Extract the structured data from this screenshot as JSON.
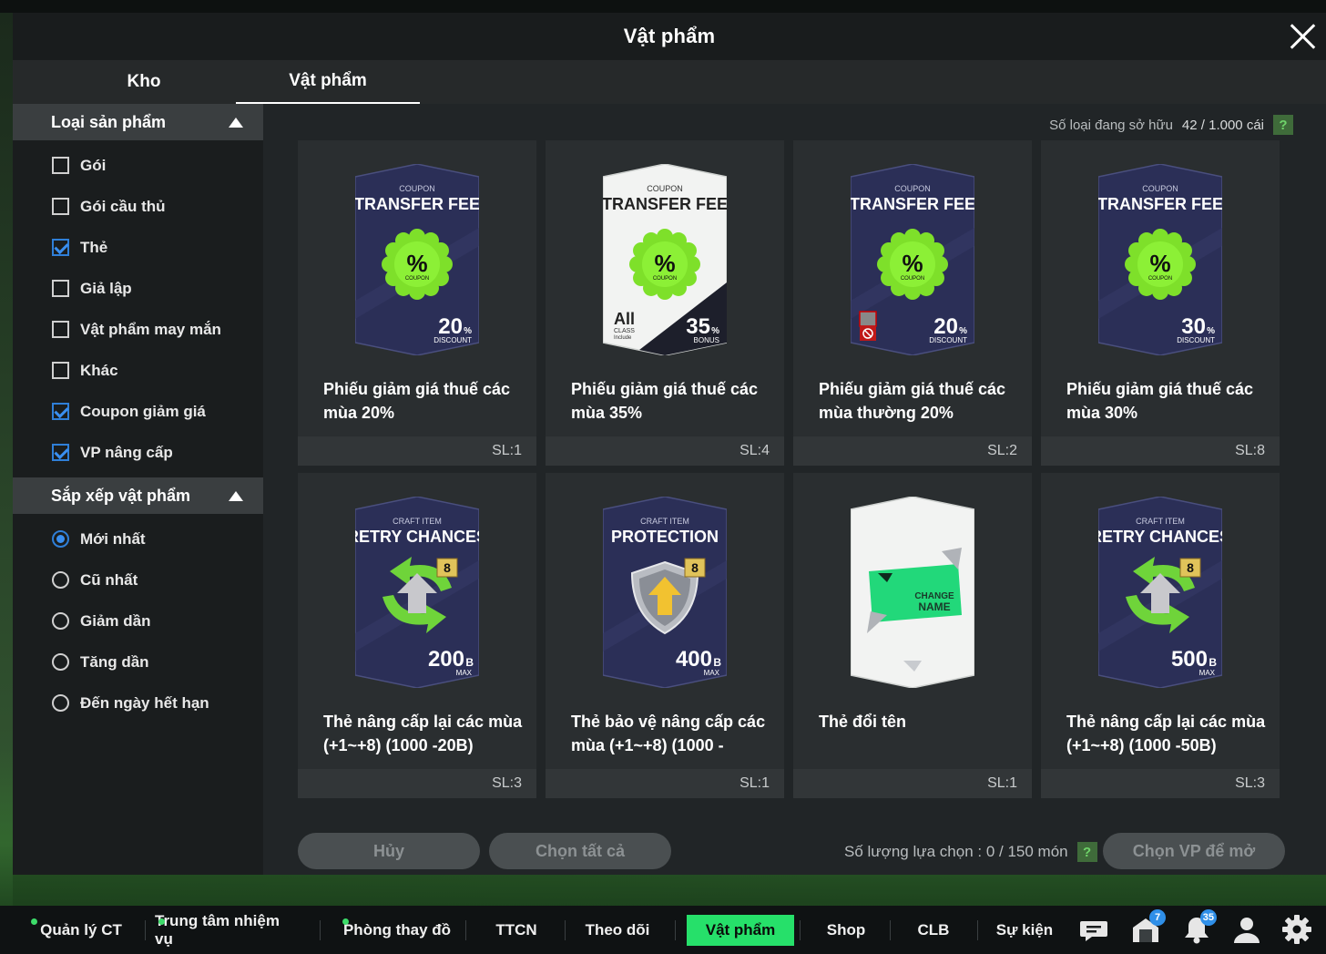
{
  "modal": {
    "title": "Vật phẩm"
  },
  "tabs": [
    {
      "label": "Kho"
    },
    {
      "label": "Vật phẩm"
    }
  ],
  "sidebar": {
    "filter_title": "Loại sản phẩm",
    "filters": [
      {
        "label": "Gói",
        "checked": false
      },
      {
        "label": "Gói cầu thủ",
        "checked": false
      },
      {
        "label": "Thẻ",
        "checked": true
      },
      {
        "label": "Giả lập",
        "checked": false
      },
      {
        "label": "Vật phẩm may mắn",
        "checked": false
      },
      {
        "label": "Khác",
        "checked": false
      },
      {
        "label": "Coupon giảm giá",
        "checked": true
      },
      {
        "label": "VP nâng cấp",
        "checked": true
      }
    ],
    "sort_title": "Sắp xếp vật phẩm",
    "sorts": [
      {
        "label": "Mới nhất",
        "selected": true
      },
      {
        "label": "Cũ nhất",
        "selected": false
      },
      {
        "label": "Giảm dần",
        "selected": false
      },
      {
        "label": "Tăng dần",
        "selected": false
      },
      {
        "label": "Đến ngày hết hạn",
        "selected": false
      }
    ]
  },
  "owned": {
    "label": "Số loại đang sở hữu",
    "count": "42 / 1.000 cái",
    "help": "?"
  },
  "items": [
    {
      "name": "Phiếu giảm giá thuế các mùa 20%",
      "qty": "SL:1",
      "art": {
        "kind": "coupon",
        "theme": "dark",
        "top": "COUPON",
        "title": "TRANSFER FEE",
        "badge": "%",
        "badge_sub": "COUPON",
        "value": "20",
        "unit": "%",
        "sub": "DISCOUNT"
      }
    },
    {
      "name": "Phiếu giảm giá thuế các mùa 35%",
      "qty": "SL:4",
      "art": {
        "kind": "coupon",
        "theme": "light",
        "top": "COUPON",
        "title": "TRANSFER FEE",
        "badge": "%",
        "badge_sub": "COUPON",
        "value": "35",
        "unit": "%",
        "sub": "BONUS",
        "corner_big": "All",
        "corner_small1": "CLASS",
        "corner_small2": "Include"
      }
    },
    {
      "name": "Phiếu giảm giá thuế các mùa thường 20%",
      "qty": "SL:2",
      "art": {
        "kind": "coupon",
        "theme": "dark",
        "top": "COUPON",
        "title": "TRANSFER FEE",
        "badge": "%",
        "badge_sub": "COUPON",
        "value": "20",
        "unit": "%",
        "sub": "DISCOUNT",
        "restricted": true
      }
    },
    {
      "name": "Phiếu giảm giá thuế các mùa 30%",
      "qty": "SL:8",
      "art": {
        "kind": "coupon",
        "theme": "dark",
        "top": "COUPON",
        "title": "TRANSFER FEE",
        "badge": "%",
        "badge_sub": "COUPON",
        "value": "30",
        "unit": "%",
        "sub": "DISCOUNT"
      }
    },
    {
      "name": "Thẻ nâng cấp lại các mùa (+1~+8) (1000 -20B)",
      "qty": "SL:3",
      "art": {
        "kind": "retry",
        "theme": "dark",
        "top": "CRAFT ITEM",
        "title": "RETRY CHANCES",
        "level": "8",
        "value": "200",
        "unit": "B",
        "sub": "MAX"
      }
    },
    {
      "name": "Thẻ bảo vệ nâng cấp các mùa (+1~+8) (1000 -",
      "qty": "SL:1",
      "art": {
        "kind": "protect",
        "theme": "dark",
        "top": "CRAFT ITEM",
        "title": "PROTECTION",
        "level": "8",
        "value": "400",
        "unit": "B",
        "sub": "MAX"
      }
    },
    {
      "name": "Thẻ đổi tên",
      "qty": "SL:1",
      "art": {
        "kind": "rename",
        "theme": "light",
        "line1": "CHANGE",
        "line2": "NAME"
      }
    },
    {
      "name": "Thẻ nâng cấp lại các mùa (+1~+8) (1000 -50B)",
      "qty": "SL:3",
      "art": {
        "kind": "retry",
        "theme": "dark",
        "top": "CRAFT ITEM",
        "title": "RETRY CHANCES",
        "level": "8",
        "value": "500",
        "unit": "B",
        "sub": "MAX"
      }
    }
  ],
  "actions": {
    "cancel": "Hủy",
    "select_all": "Chọn tất cả",
    "selection_label": "Số lượng lựa chọn : 0 / 150 món",
    "help": "?",
    "open": "Chọn VP để mở"
  },
  "bottom_nav": {
    "items": [
      {
        "label": "Quản lý CT",
        "dot": true
      },
      {
        "label": "Trung tâm nhiệm vụ",
        "dot": true
      },
      {
        "label": "Phòng thay đồ",
        "dot": true
      },
      {
        "label": "TTCN",
        "dot": false
      },
      {
        "label": "Theo dõi",
        "dot": false
      },
      {
        "label": "Vật phẩm",
        "dot": false,
        "active": true
      },
      {
        "label": "Shop",
        "dot": false
      },
      {
        "label": "CLB",
        "dot": false
      },
      {
        "label": "Sự kiện",
        "dot": false
      }
    ],
    "icons": [
      {
        "name": "chat-icon"
      },
      {
        "name": "inbox-icon",
        "badge": "7"
      },
      {
        "name": "notification-bell-icon",
        "badge": "35"
      },
      {
        "name": "profile-icon"
      },
      {
        "name": "settings-gear-icon"
      }
    ]
  },
  "colors": {
    "accent_green": "#26e06a",
    "checkbox_blue": "#3a8ff0",
    "card_dark": "#2a2f52",
    "coupon_green": "#7ee02a"
  }
}
